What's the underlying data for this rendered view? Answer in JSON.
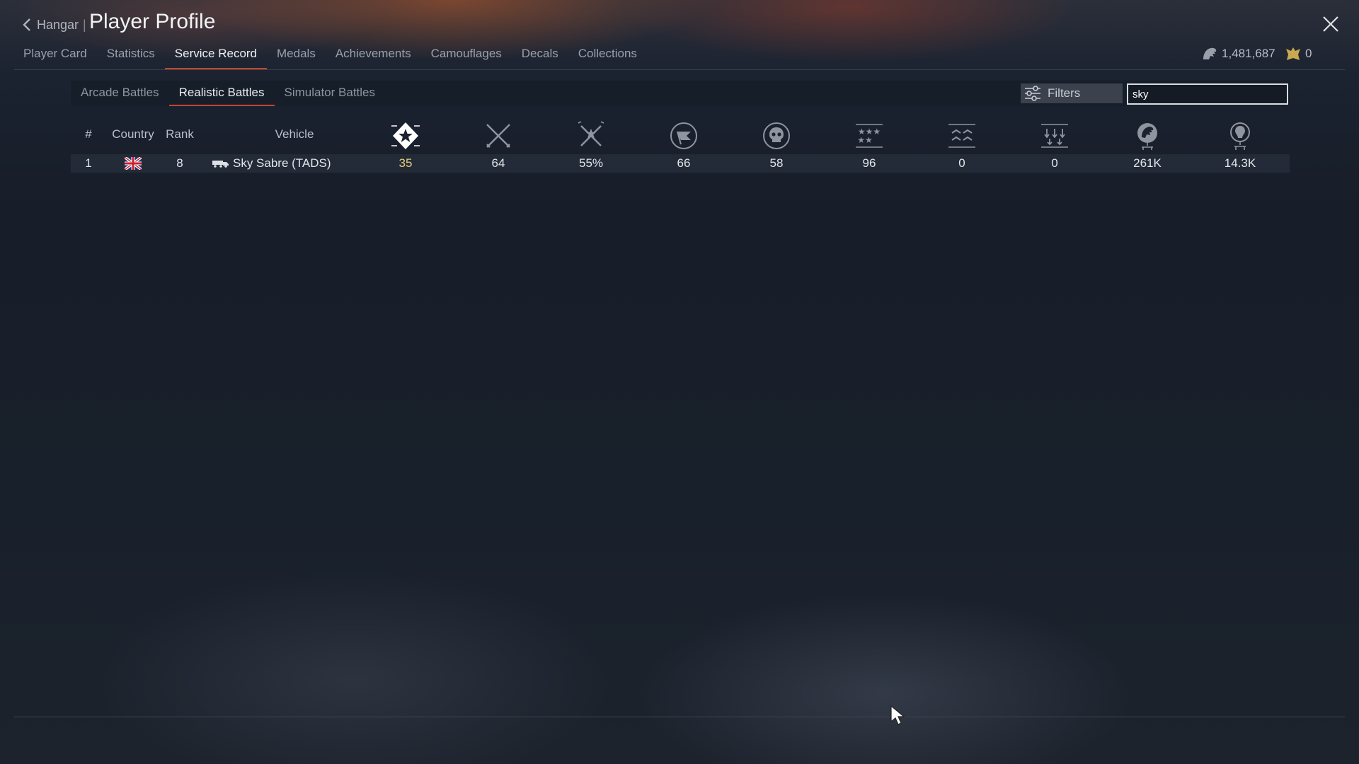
{
  "header": {
    "back_label": "Hangar",
    "separator": "|",
    "title": "Player Profile"
  },
  "main_tabs": [
    "Player Card",
    "Statistics",
    "Service Record",
    "Medals",
    "Achievements",
    "Camouflages",
    "Decals",
    "Collections"
  ],
  "active_main_tab": "Service Record",
  "currency": {
    "silver_lions": "1,481,687",
    "golden_eagles": "0"
  },
  "mode_tabs": [
    "Arcade Battles",
    "Realistic Battles",
    "Simulator Battles"
  ],
  "active_mode_tab": "Realistic Battles",
  "filters_label": "Filters",
  "search": {
    "value": "sky"
  },
  "table": {
    "columns": {
      "index": "#",
      "country": "Country",
      "rank": "Rank",
      "vehicle": "Vehicle"
    },
    "stat_icons": [
      "rating-star-icon",
      "battles-swords-icon",
      "win-rate-icon",
      "flag-capture-icon",
      "deaths-skull-icon",
      "stars-icon",
      "air-kills-icon",
      "ground-kills-icon",
      "silver-lions-icon",
      "research-points-icon"
    ],
    "rows": [
      {
        "index": "1",
        "country": "Great Britain",
        "rank": "8",
        "vehicle": "Sky Sabre (TADS)",
        "stats": [
          "35",
          "64",
          "55%",
          "66",
          "58",
          "96",
          "0",
          "0",
          "261K",
          "14.3K"
        ]
      }
    ]
  },
  "colors": {
    "accent_underline": "#c7452e",
    "highlight_value": "#e9cf7a"
  }
}
